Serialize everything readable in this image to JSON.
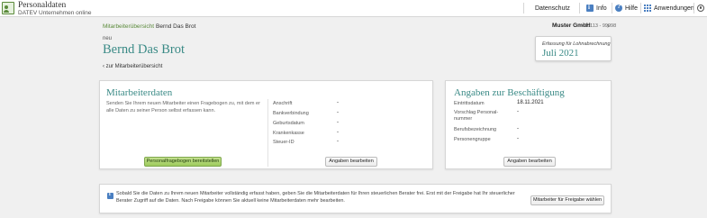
{
  "app": {
    "title": "Personaldaten",
    "subtitle": "DATEV Unternehmen online"
  },
  "topnav": {
    "datenschutz": "Datenschutz",
    "info": "Info",
    "hilfe": "Hilfe",
    "anwendungen": "Anwendungen"
  },
  "breadcrumb": {
    "parent": "Mitarbeiterübersicht",
    "current": "Bernd Das Brot"
  },
  "company": {
    "name": "Muster GmbH",
    "number": "458113 - 99998"
  },
  "employee": {
    "status": "neu",
    "name": "Bernd Das Brot",
    "back_link": "zur Mitarbeiterübersicht"
  },
  "period": {
    "label": "Erfassung für Lohnabrechnung",
    "value": "Juli 2021"
  },
  "mitarbeiterdaten": {
    "title": "Mitarbeiterdaten",
    "description": "Senden Sie Ihrem neuen Mitarbeiter einen Fragebogen zu, mit dem er alle Daten zu seiner Person selbst erfassen kann.",
    "questionnaire_button": "Personalfragebogen bereitstellen",
    "fields": [
      {
        "label": "Anschrift",
        "value": "-"
      },
      {
        "label": "Bankverbindung",
        "value": "-"
      },
      {
        "label": "Geburtsdatum",
        "value": "-"
      },
      {
        "label": "Krankenkasse",
        "value": "-"
      },
      {
        "label": "Steuer-ID",
        "value": "-"
      }
    ],
    "edit_button": "Angaben bearbeiten"
  },
  "beschaeftigung": {
    "title": "Angaben zur Beschäftigung",
    "fields": [
      {
        "label": "Eintrittsdatum",
        "value": "18.11.2021"
      },
      {
        "label": "Vorschlag Personal-nummer",
        "value": "-"
      },
      {
        "label": "Berufsbezeichnung",
        "value": "-"
      },
      {
        "label": "Personengruppe",
        "value": "-"
      }
    ],
    "edit_button": "Angaben bearbeiten"
  },
  "notice": {
    "text": "Sobald Sie die Daten zu Ihrem neuen Mitarbeiter vollständig erfasst haben, geben Sie die Mitarbeiterdaten für Ihren steuerlichen Berater frei. Erst mit der Freigabe hat Ihr steuerlicher Berater Zugriff auf die Daten. Nach Freigabe können Sie aktuell keine Mitarbeiterdaten mehr bearbeiten.",
    "button": "Mitarbeiter für Freigabe wählen"
  },
  "colors": {
    "accent_teal": "#3a8a86",
    "link_green": "#5a8a3a",
    "button_green": "#9ecb5c",
    "icon_blue": "#4a7fc1"
  }
}
